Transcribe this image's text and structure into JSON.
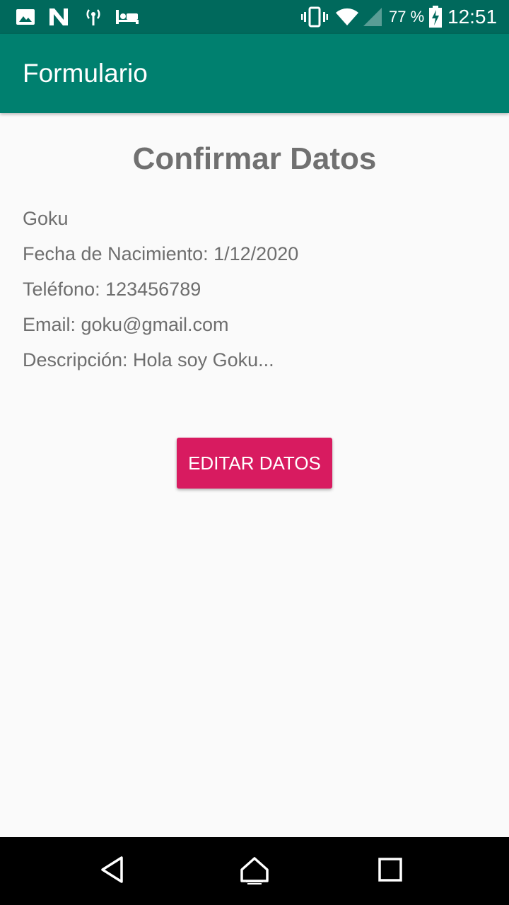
{
  "status_bar": {
    "battery_percent": "77 %",
    "time": "12:51",
    "left_icons": [
      "image-icon",
      "n-notification-icon",
      "hotspot-icon",
      "bed-icon"
    ],
    "right_icons": [
      "vibrate-icon",
      "wifi-icon",
      "signal-icon",
      "battery-charging-icon"
    ]
  },
  "app_bar": {
    "title": "Formulario",
    "color": "#00806f"
  },
  "main": {
    "title": "Confirmar Datos",
    "lines": [
      "Goku",
      "Fecha de Nacimiento: 1/12/2020",
      "Teléfono: 123456789",
      "Email: goku@gmail.com",
      "Descripción: Hola soy Goku..."
    ],
    "edit_button_label": "EDITAR DATOS",
    "accent_color": "#d81b60"
  },
  "nav_bar": {
    "buttons": [
      "back-icon",
      "home-icon",
      "recents-icon"
    ]
  }
}
